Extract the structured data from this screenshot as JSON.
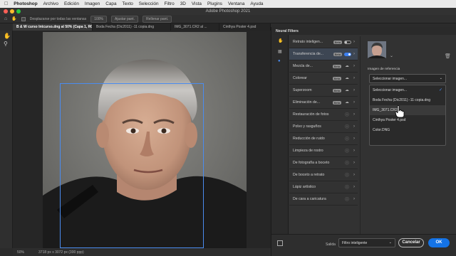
{
  "menubar": {
    "app": "Photoshop",
    "items": [
      "Archivo",
      "Edición",
      "Imagen",
      "Capa",
      "Texto",
      "Selección",
      "Filtro",
      "3D",
      "Vista",
      "Plugins",
      "Ventana",
      "Ayuda"
    ]
  },
  "window": {
    "title": "Adobe Photoshop 2021"
  },
  "options": {
    "scroll_all_label": "Desplazarse por todas las ventanas",
    "zoom_value": "100%",
    "fit_label": "Ajustar pant.",
    "fill_label": "Rellenar pant."
  },
  "tabs": [
    {
      "label": "B & W curso Intcurso.dng al 50% (Capa 1, RGB/8) *"
    },
    {
      "label": "Boda Fecha (Dic2011) -11 copia.dng"
    },
    {
      "label": "IMG_3071.CR2 al ..."
    },
    {
      "label": "Cinthya Poster 4.psd"
    }
  ],
  "status": {
    "zoom": "50%",
    "dimensions": "3718 px x 3072 px (300 ppp)"
  },
  "neural_filters": {
    "header": "Neural Filters",
    "filters": [
      {
        "name": "Retrato inteligen...",
        "badge": "Beta",
        "control": "toggle"
      },
      {
        "name": "Transferencia de...",
        "badge": "Beta",
        "control": "toggle-on",
        "selected": true
      },
      {
        "name": "Mezcla de...",
        "badge": "Beta",
        "control": "cloud"
      },
      {
        "name": "Colorear",
        "badge": "Beta",
        "control": "cloud"
      },
      {
        "name": "Superzoom",
        "badge": "Beta",
        "control": "cloud"
      },
      {
        "name": "Eliminación de...",
        "badge": "Beta",
        "control": "cloud"
      },
      {
        "name": "Restauración de fotos",
        "badge": "",
        "control": "info"
      },
      {
        "name": "Polvo y rasguños",
        "badge": "",
        "control": "info"
      },
      {
        "name": "Reducción de ruido",
        "badge": "",
        "control": "info"
      },
      {
        "name": "Limpieza de rostro",
        "badge": "",
        "control": "info"
      },
      {
        "name": "De fotografía a boceto",
        "badge": "",
        "control": "info"
      },
      {
        "name": "De boceto a retrato",
        "badge": "",
        "control": "info"
      },
      {
        "name": "Lápiz artístico",
        "badge": "",
        "control": "info"
      },
      {
        "name": "De cara a caricatura",
        "badge": "",
        "control": "info"
      }
    ],
    "reference_label": "Imagen de referencia",
    "select_value": "Seleccionar imagen...",
    "dropdown_options": [
      {
        "label": "Seleccionar imagen...",
        "checked": true
      },
      {
        "label": "Boda Fecha (Dic2011) -11 copia.dng",
        "checked": false
      },
      {
        "label": "IMG_3071.CR2",
        "checked": false,
        "highlighted": true
      },
      {
        "label": "Cinthya Poster 4.psd",
        "checked": false
      },
      {
        "label": "Color.DNG",
        "checked": false
      }
    ],
    "output_label": "Salida",
    "output_value": "Filtro inteligente",
    "cancel_label": "Cancelar",
    "ok_label": "OK"
  },
  "colors": {
    "accent": "#1473e6",
    "selection": "#3d4653",
    "panel": "#323232"
  }
}
